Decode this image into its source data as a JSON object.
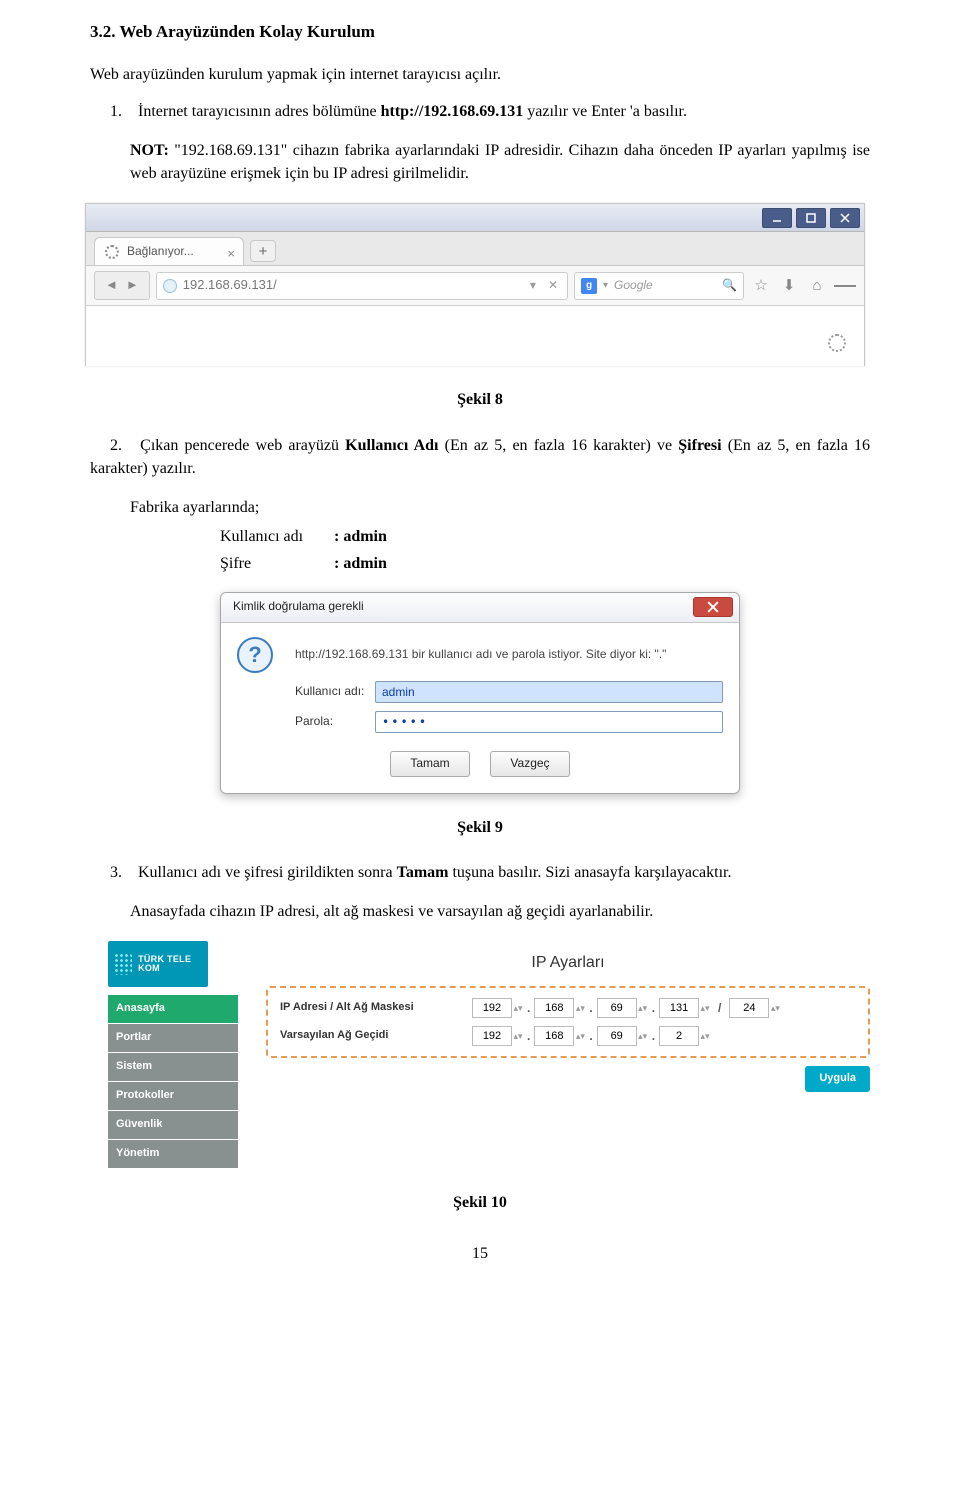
{
  "section": {
    "title": "3.2. Web Arayüzünden Kolay Kurulum"
  },
  "intro": "Web arayüzünden kurulum yapmak için internet tarayıcısı açılır.",
  "step1": {
    "num": "1.",
    "text_a": "İnternet tarayıcısının adres bölümüne ",
    "url_bold": "http://192.168.69.131",
    "text_b": " yazılır ve Enter 'a basılır.",
    "note_label": "NOT:",
    "note_text": " \"192.168.69.131\" cihazın fabrika ayarlarındaki IP adresidir. Cihazın daha önceden IP ayarları yapılmış ise web arayüzüne erişmek için bu IP adresi girilmelidir."
  },
  "captions": {
    "fig8": "Şekil 8",
    "fig9": "Şekil 9",
    "fig10": "Şekil 10"
  },
  "step2": {
    "num": "2.",
    "text_a": "Çıkan pencerede web arayüzü ",
    "b1": "Kullanıcı Adı",
    "text_b": " (En az 5, en fazla 16 karakter) ve ",
    "b2": "Şifresi",
    "text_c": " (En az 5, en fazla 16 karakter) yazılır.",
    "factory": "Fabrika ayarlarında;",
    "user_label": "Kullanıcı adı",
    "user_value": ": admin",
    "pass_label": "Şifre",
    "pass_value": ": admin"
  },
  "step3": {
    "num": "3.",
    "text_a": "Kullanıcı adı ve şifresi girildikten sonra ",
    "bold": "Tamam",
    "text_b": " tuşuna basılır. Sizi anasayfa karşılayacaktır.",
    "body2": "Anasayfada cihazın IP adresi, alt ağ maskesi ve varsayılan ağ geçidi ayarlanabilir."
  },
  "browser": {
    "tab_title": "Bağlanıyor...",
    "url": "192.168.69.131/",
    "search_provider": "g",
    "search_placeholder": "Google"
  },
  "auth": {
    "title": "Kimlik doğrulama gerekli",
    "message": "http://192.168.69.131 bir kullanıcı adı ve parola istiyor. Site diyor ki: \".\"",
    "label_user": "Kullanıcı adı:",
    "label_pass": "Parola:",
    "val_user": "admin",
    "val_pass": "•••••",
    "ok": "Tamam",
    "cancel": "Vazgeç"
  },
  "panel": {
    "logo": "TÜRK TELE KOM",
    "menu": [
      "Anasayfa",
      "Portlar",
      "Sistem",
      "Protokoller",
      "Güvenlik",
      "Yönetim"
    ],
    "title": "IP Ayarları",
    "row1_label": "IP Adresi / Alt Ağ Maskesi",
    "row2_label": "Varsayılan Ağ Geçidi",
    "ip_a": [
      "192",
      "168",
      "69",
      "131"
    ],
    "mask": "24",
    "ip_b": [
      "192",
      "168",
      "69",
      "2"
    ],
    "apply": "Uygula"
  },
  "page_number": "15"
}
